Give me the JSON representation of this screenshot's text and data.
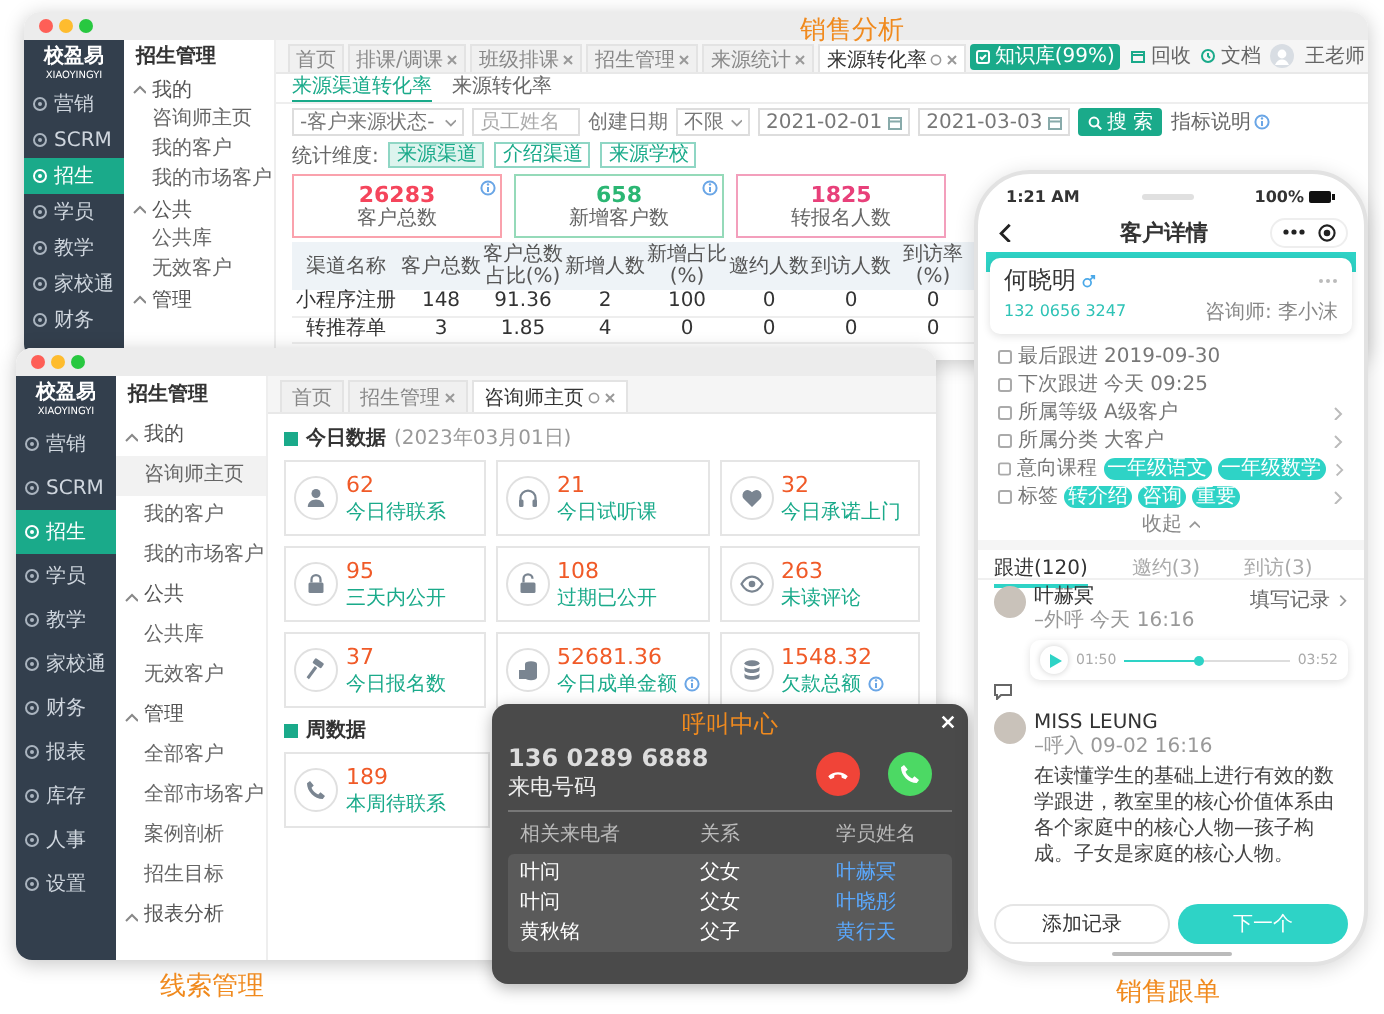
{
  "back_window": {
    "caption": "销售分析",
    "logo": {
      "name": "校盈易",
      "tagline": "XIAOYINGYI"
    },
    "sidebar": [
      {
        "label": "营销",
        "selected": false
      },
      {
        "label": "SCRM",
        "selected": false
      },
      {
        "label": "招生",
        "selected": true
      },
      {
        "label": "学员",
        "selected": false
      },
      {
        "label": "教学",
        "selected": false
      },
      {
        "label": "家校通",
        "selected": false
      },
      {
        "label": "财务",
        "selected": false
      }
    ],
    "subnav": {
      "title": "招生管理",
      "groups": [
        {
          "label": "我的",
          "expanded": true,
          "children": [
            {
              "label": "咨询师主页",
              "selected": false
            },
            {
              "label": "我的客户",
              "selected": false
            },
            {
              "label": "我的市场客户",
              "selected": false
            }
          ]
        },
        {
          "label": "公共",
          "expanded": true,
          "children": [
            {
              "label": "公共库",
              "selected": false
            },
            {
              "label": "无效客户",
              "selected": false
            }
          ]
        },
        {
          "label": "管理",
          "expanded": true
        }
      ]
    },
    "tabs": [
      {
        "label": "首页",
        "selected": false,
        "closable": false
      },
      {
        "label": "排课/调课",
        "selected": false,
        "closable": true
      },
      {
        "label": "班级排课",
        "selected": false,
        "closable": true
      },
      {
        "label": "招生管理",
        "selected": false,
        "closable": true
      },
      {
        "label": "来源统计",
        "selected": false,
        "closable": true
      },
      {
        "label": "来源转化率",
        "selected": true,
        "closable": true
      }
    ],
    "header": {
      "badge": "知识库(99%)",
      "links": [
        "回收",
        "文档"
      ],
      "user": "王老师"
    },
    "subtabs": [
      {
        "label": "来源渠道转化率",
        "selected": true
      },
      {
        "label": "来源转化率",
        "selected": false
      }
    ],
    "filters": {
      "source": "-客户来源状态-",
      "staff_placeholder": "员工姓名",
      "date_label": "创建日期",
      "date_range": "不限",
      "date_from": "2021-02-01",
      "date_to": "2021-03-03",
      "search": "搜 索",
      "help": "指标说明"
    },
    "dimensions": {
      "label": "统计维度:",
      "chips": [
        {
          "label": "来源渠道",
          "selected": true
        },
        {
          "label": "介绍渠道",
          "selected": false
        },
        {
          "label": "来源学校",
          "selected": false
        }
      ]
    },
    "stats": [
      {
        "value": "26283",
        "label": "客户总数",
        "color": "#f5455c",
        "info": true
      },
      {
        "value": "658",
        "label": "新增客户数",
        "color": "#2bb673",
        "info": true
      },
      {
        "value": "1825",
        "label": "转报名人数",
        "color": "#e8407a",
        "info": false
      }
    ],
    "table": {
      "columns": [
        "渠道名称",
        "客户总数",
        "客户总数占比(%)",
        "新增人数",
        "新增占比(%)",
        "邀约人数",
        "到访人数",
        "到访率(%)"
      ],
      "rows": [
        [
          "小程序注册",
          "148",
          "91.36",
          "2",
          "100",
          "0",
          "0",
          "0"
        ],
        [
          "转推荐单",
          "3",
          "1.85",
          "4",
          "0",
          "0",
          "0",
          "0"
        ]
      ]
    }
  },
  "front_window": {
    "caption": "线索管理",
    "logo": {
      "name": "校盈易",
      "tagline": "XIAOYINGYI"
    },
    "sidebar": [
      {
        "label": "营销",
        "selected": false
      },
      {
        "label": "SCRM",
        "selected": false
      },
      {
        "label": "招生",
        "selected": true
      },
      {
        "label": "学员",
        "selected": false
      },
      {
        "label": "教学",
        "selected": false
      },
      {
        "label": "家校通",
        "selected": false
      },
      {
        "label": "财务",
        "selected": false
      },
      {
        "label": "报表",
        "selected": false
      },
      {
        "label": "库存",
        "selected": false
      },
      {
        "label": "人事",
        "selected": false
      },
      {
        "label": "设置",
        "selected": false
      }
    ],
    "subnav": {
      "title": "招生管理",
      "groups": [
        {
          "label": "我的",
          "expanded": true,
          "children": [
            {
              "label": "咨询师主页",
              "selected": true
            },
            {
              "label": "我的客户",
              "selected": false
            },
            {
              "label": "我的市场客户",
              "selected": false
            }
          ]
        },
        {
          "label": "公共",
          "expanded": true,
          "children": [
            {
              "label": "公共库",
              "selected": false
            },
            {
              "label": "无效客户",
              "selected": false
            }
          ]
        },
        {
          "label": "管理",
          "expanded": true,
          "children": [
            {
              "label": "全部客户",
              "selected": false
            },
            {
              "label": "全部市场客户",
              "selected": false
            },
            {
              "label": "案例剖析",
              "selected": false
            },
            {
              "label": "招生目标",
              "selected": false
            }
          ]
        },
        {
          "label": "报表分析",
          "expanded": true
        }
      ]
    },
    "tabs": [
      {
        "label": "首页",
        "selected": false,
        "closable": false
      },
      {
        "label": "招生管理",
        "selected": false,
        "closable": true
      },
      {
        "label": "咨询师主页",
        "selected": true,
        "closable": true
      }
    ],
    "today": {
      "title": "今日数据",
      "date": "(2023年03月01日)",
      "cards": [
        {
          "value": "62",
          "label": "今日待联系",
          "info": false
        },
        {
          "value": "21",
          "label": "今日试听课",
          "info": false
        },
        {
          "value": "32",
          "label": "今日承诺上门",
          "info": false
        },
        {
          "value": "95",
          "label": "三天内公开",
          "info": false
        },
        {
          "value": "108",
          "label": "过期已公开",
          "info": false
        },
        {
          "value": "263",
          "label": "未读评论",
          "info": false
        },
        {
          "value": "37",
          "label": "今日报名数",
          "info": false
        },
        {
          "value": "52681.36",
          "label": "今日成单金额",
          "info": true
        },
        {
          "value": "1548.32",
          "label": "欠款总额",
          "info": true
        }
      ]
    },
    "week": {
      "title": "周数据",
      "cards": [
        {
          "value": "189",
          "label": "本周待联系",
          "info": false
        }
      ]
    }
  },
  "call_dialog": {
    "title": "呼叫中心",
    "number": "136 0289 6888",
    "number_label": "来电号码",
    "columns": [
      "相关来电者",
      "关系",
      "学员姓名"
    ],
    "rows": [
      [
        "叶问",
        "父女",
        "叶赫冥"
      ],
      [
        "叶问",
        "父女",
        "叶晓彤"
      ],
      [
        "黄秋铭",
        "父子",
        "黄行天"
      ]
    ]
  },
  "phone": {
    "caption": "销售跟单",
    "time": "1:21 AM",
    "battery": "100%",
    "title": "客户详情",
    "customer": {
      "name": "何晓明",
      "phone": "132 0656 3247",
      "advisor": "咨询师: 李小沫"
    },
    "fields": [
      {
        "kind": "text",
        "label": "最后跟进",
        "value": "2019-09-30",
        "link": false
      },
      {
        "kind": "text",
        "label": "下次跟进",
        "value": "今天 09:25",
        "link": false
      },
      {
        "kind": "text",
        "label": "所属等级",
        "value": "A级客户",
        "link": true
      },
      {
        "kind": "text",
        "label": "所属分类",
        "value": "大客户",
        "link": true
      },
      {
        "kind": "chips",
        "label": "意向课程",
        "chips": [
          "一年级语文",
          "一年级数学"
        ],
        "link": true
      },
      {
        "kind": "chips",
        "label": "标签",
        "chips": [
          "转介绍",
          "咨询",
          "重要"
        ],
        "link": true
      }
    ],
    "collapse": "收起",
    "tabs": [
      {
        "label": "跟进(120)",
        "selected": true
      },
      {
        "label": "邀约(3)",
        "selected": false
      },
      {
        "label": "到访(3)",
        "selected": false
      }
    ],
    "records": [
      {
        "kind": "audio",
        "author": "叶赫冥",
        "meta": "–外呼  今天 16:16",
        "action": "填写记录",
        "start": "01:50",
        "end": "03:52",
        "level": 0.45
      },
      {
        "kind": "note",
        "author": "MISS LEUNG",
        "meta": "–呼入  09-02 16:16",
        "text": "在读懂学生的基础上进行有效的数学跟进，教室里的核心价值体系由各个家庭中的核心人物—孩子构成。子女是家庭的核心人物。"
      }
    ],
    "buttons": {
      "secondary": "添加记录",
      "primary": "下一个"
    }
  }
}
